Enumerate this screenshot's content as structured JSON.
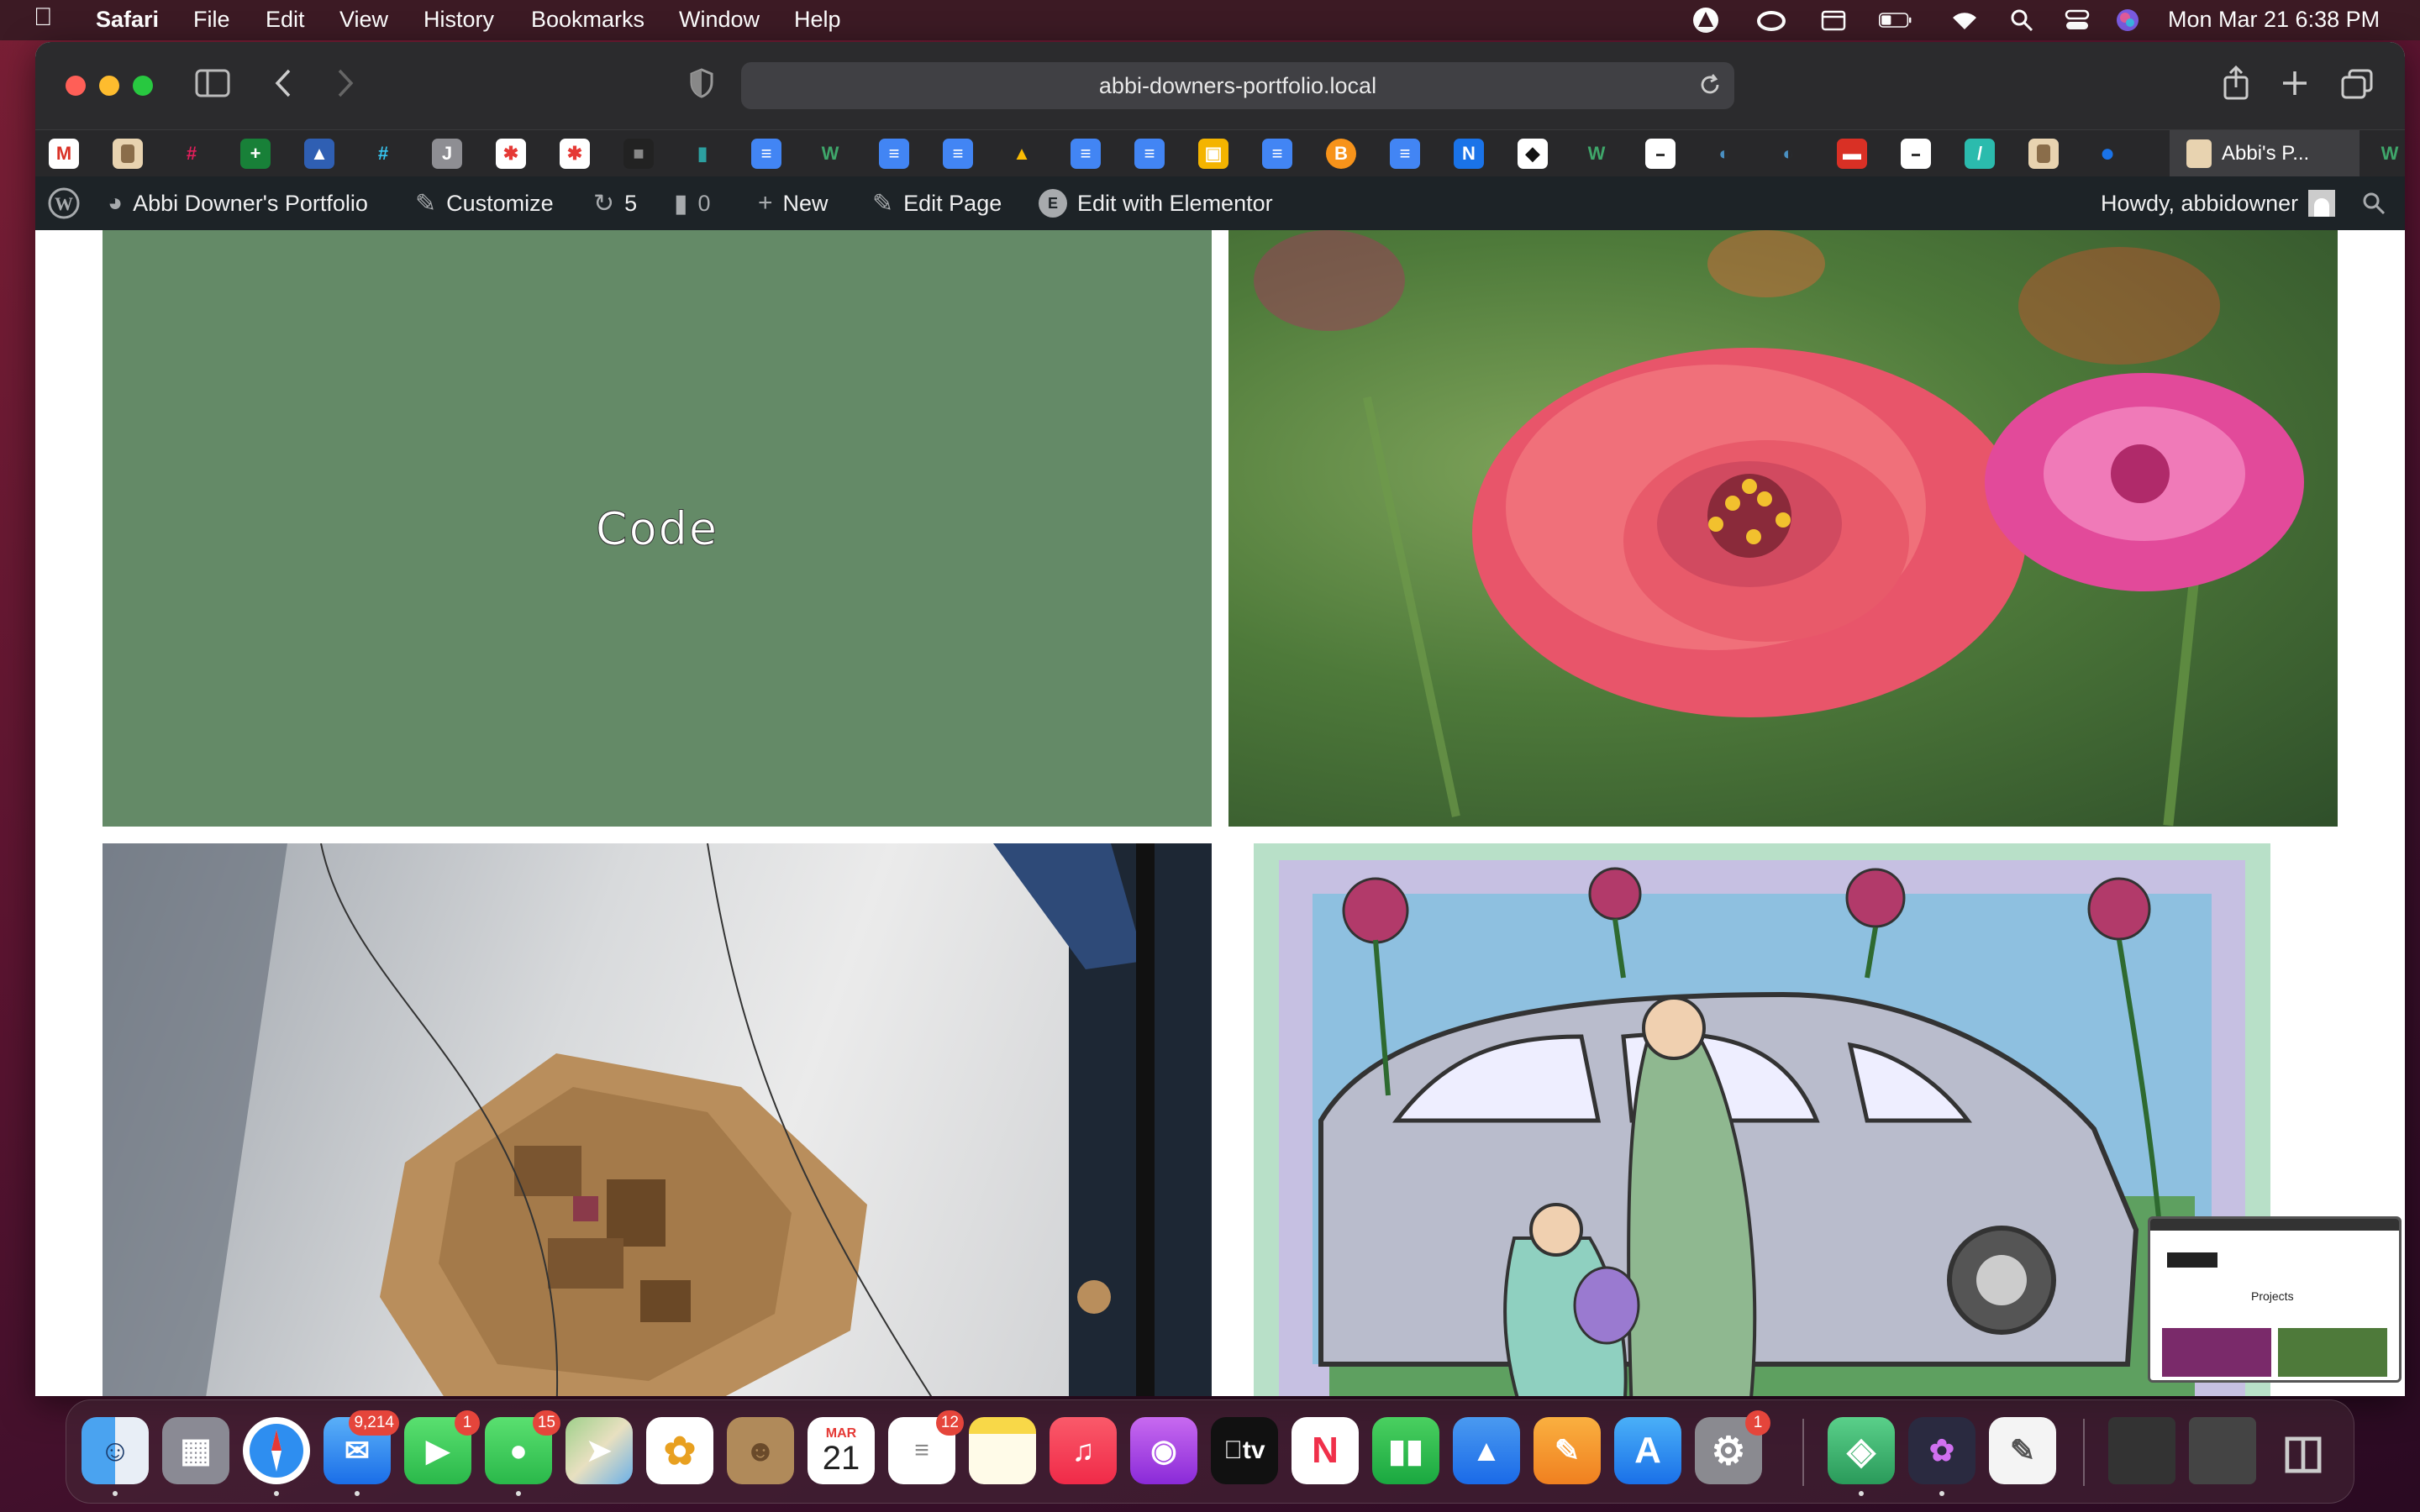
{
  "menubar": {
    "app": "Safari",
    "items": [
      "File",
      "Edit",
      "View",
      "History",
      "Bookmarks",
      "Window",
      "Help"
    ],
    "clock": "Mon Mar 21  6:38 PM"
  },
  "browser": {
    "url": "abbi-downers-portfolio.local",
    "active_tab": "Abbi's P..."
  },
  "admin_bar": {
    "site_name": "Abbi Downer's Portfolio",
    "customize": "Customize",
    "updates_count": "5",
    "comments_count": "0",
    "new": "New",
    "edit_page": "Edit Page",
    "edit_elementor": "Edit with Elementor",
    "howdy": "Howdy, abbidowner"
  },
  "page": {
    "code_tile_label": "Code",
    "code_tile_color": "#648a67"
  },
  "dock": {
    "mail_badge": "9,214",
    "facetime_badge": "1",
    "messages_badge": "15",
    "calendar_month": "MAR",
    "calendar_day": "21",
    "reminders_badge": "12",
    "settings_badge": "1",
    "appletv_label": "tv"
  },
  "thumbnail": {
    "heading": "Projects"
  }
}
